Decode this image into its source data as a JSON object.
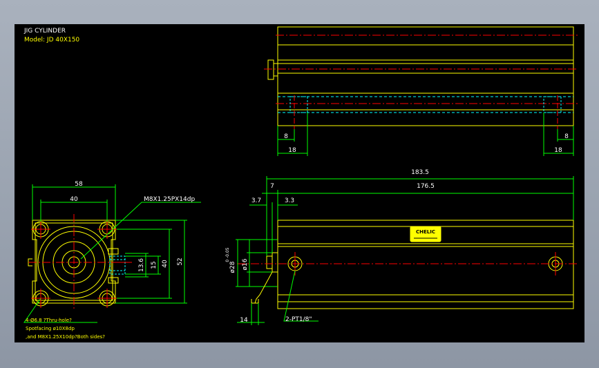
{
  "title_block": {
    "title": "JIG CYLINDER",
    "model": "Model: JD 40X150"
  },
  "colors": {
    "background": "#000000",
    "outline": "#ffff00",
    "dimension": "#00ff00",
    "centerline": "#ff0000",
    "hidden": "#00ffff",
    "white": "#ffffff"
  },
  "top_view": {
    "dims": {
      "left_small": "8",
      "left_large": "18",
      "right_large": "18",
      "right_small": "8"
    }
  },
  "end_view": {
    "dims": {
      "width_outer": "58",
      "width_inner": "40",
      "port_callout": "M8X1.25PX14dp",
      "h_13_6": "13.6",
      "h_15": "15",
      "h_40": "40",
      "h_52": "52"
    },
    "notes": [
      "4-Ø6.8 ?Thru-hole?",
      "Spotfacing  ø10X8dp",
      ",and M8X1.25X10dp?Both sides?"
    ]
  },
  "side_view": {
    "dims": {
      "overall": "183.5",
      "body": "176.5",
      "rod_ext": "7",
      "d_3_7": "3.7",
      "d_3_3": "3.3",
      "rod_dia": "ø16",
      "boss_dia": "ø28",
      "boss_tol": "0\n-0.05",
      "wrench": "14",
      "ports": "2-PT1/8\""
    },
    "label_plate": "CHELIC"
  }
}
